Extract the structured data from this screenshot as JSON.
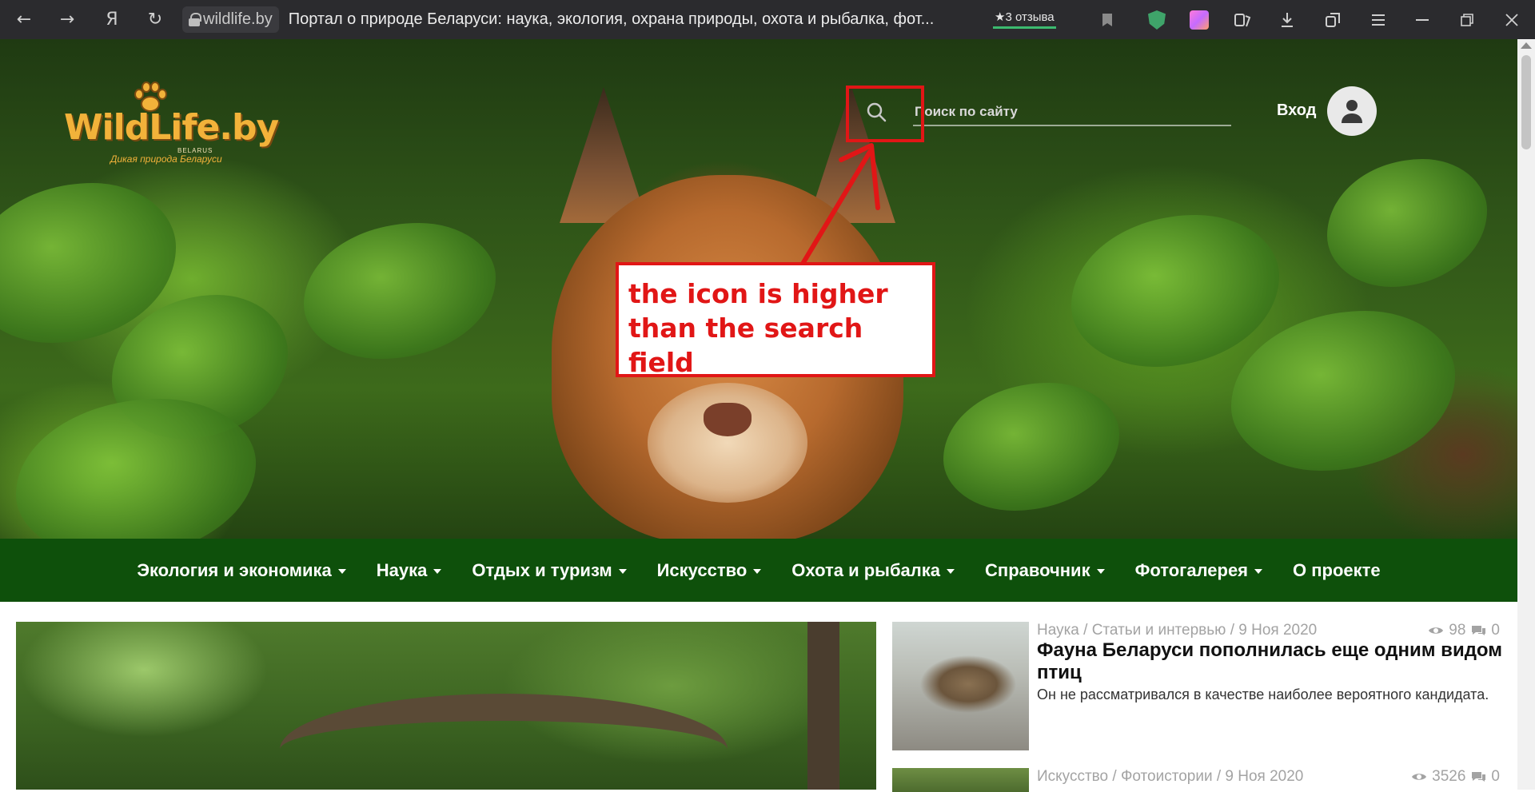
{
  "browser": {
    "domain": "wildlife.by",
    "tab_title": "Портал о природе Беларуси: наука, экология, охрана природы, охота и рыбалка, фот...",
    "reviews_label": "★3 отзыва",
    "yandex_label": "Я"
  },
  "site": {
    "logo_text": "WildLife.by",
    "logo_belarus": "BELARUS",
    "logo_tagline": "Дикая природа Беларуси",
    "search_placeholder": "Поиск по сайту",
    "login_label": "Вход"
  },
  "annotation": {
    "line1": "the icon is higher",
    "line2": "than the search field",
    "color": "#e11616"
  },
  "nav": {
    "items": [
      {
        "label": "Экология и экономика",
        "has_dropdown": true
      },
      {
        "label": "Наука",
        "has_dropdown": true
      },
      {
        "label": "Отдых и туризм",
        "has_dropdown": true
      },
      {
        "label": "Искусство",
        "has_dropdown": true
      },
      {
        "label": "Охота и рыбалка",
        "has_dropdown": true
      },
      {
        "label": "Справочник",
        "has_dropdown": true
      },
      {
        "label": "Фотогалерея",
        "has_dropdown": true
      },
      {
        "label": "О проекте",
        "has_dropdown": false
      }
    ],
    "background": "#0e500b"
  },
  "news": [
    {
      "meta": "Наука / Статьи и интервью / 9 Ноя 2020",
      "views": "98",
      "comments": "0",
      "title": "Фауна Беларуси пополнилась еще одним видом птиц",
      "excerpt": "Он не рассматривался в качестве наиболее вероятного кандидата."
    },
    {
      "meta": "Искусство / Фотоистории / 9 Ноя 2020",
      "views": "3526",
      "comments": "0",
      "title": "",
      "excerpt": ""
    }
  ]
}
